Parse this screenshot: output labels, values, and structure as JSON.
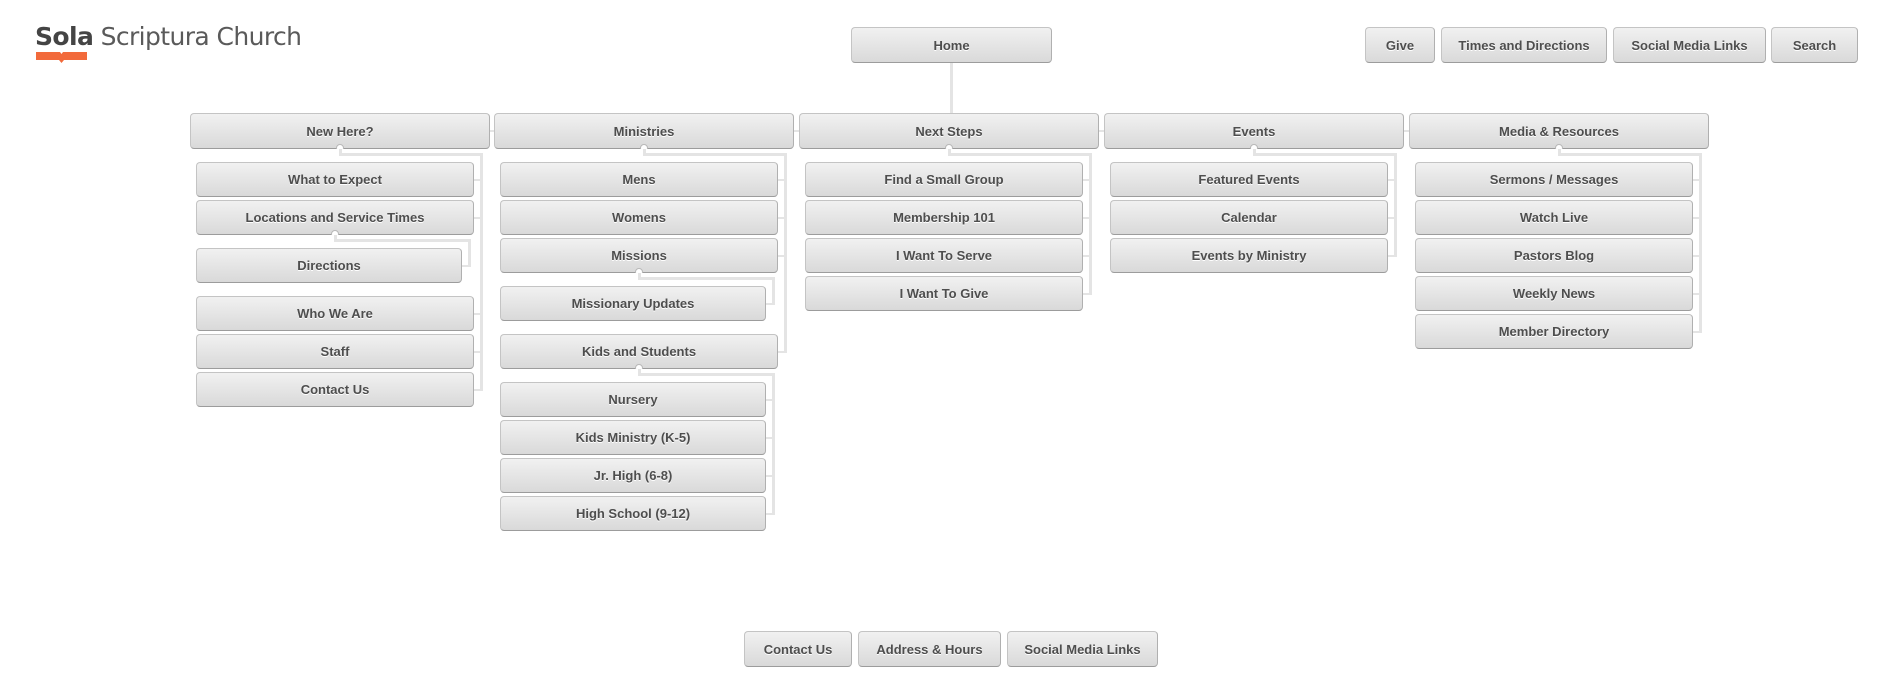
{
  "brand": {
    "name_bold": "Sola",
    "name_light": "Scriptura Church",
    "accent_color": "#f26a3b"
  },
  "utility_nav": {
    "items": [
      {
        "label": "Give"
      },
      {
        "label": "Times and Directions"
      },
      {
        "label": "Social Media Links"
      },
      {
        "label": "Search"
      }
    ]
  },
  "sitemap": {
    "root": {
      "label": "Home"
    },
    "sections": [
      {
        "label": "New Here?",
        "children": [
          {
            "label": "What to Expect"
          },
          {
            "label": "Locations and Service Times",
            "children": [
              {
                "label": "Directions"
              }
            ]
          },
          {
            "label": "Who We Are"
          },
          {
            "label": "Staff"
          },
          {
            "label": "Contact Us"
          }
        ]
      },
      {
        "label": "Ministries",
        "children": [
          {
            "label": "Mens"
          },
          {
            "label": "Womens"
          },
          {
            "label": "Missions",
            "children": [
              {
                "label": "Missionary Updates"
              }
            ]
          },
          {
            "label": "Kids and Students",
            "children": [
              {
                "label": "Nursery"
              },
              {
                "label": "Kids Ministry (K-5)"
              },
              {
                "label": "Jr. High (6-8)"
              },
              {
                "label": "High School (9-12)"
              }
            ]
          }
        ]
      },
      {
        "label": "Next Steps",
        "children": [
          {
            "label": "Find a Small Group"
          },
          {
            "label": "Membership 101"
          },
          {
            "label": "I Want To Serve"
          },
          {
            "label": "I Want To Give"
          }
        ]
      },
      {
        "label": "Events",
        "children": [
          {
            "label": "Featured Events"
          },
          {
            "label": "Calendar"
          },
          {
            "label": "Events by Ministry"
          }
        ]
      },
      {
        "label": "Media & Resources",
        "children": [
          {
            "label": "Sermons / Messages"
          },
          {
            "label": "Watch Live"
          },
          {
            "label": "Pastors Blog"
          },
          {
            "label": "Weekly News"
          },
          {
            "label": "Member Directory"
          }
        ]
      }
    ]
  },
  "footer_nav": {
    "items": [
      {
        "label": "Contact Us"
      },
      {
        "label": "Address & Hours"
      },
      {
        "label": "Social Media Links"
      }
    ]
  }
}
